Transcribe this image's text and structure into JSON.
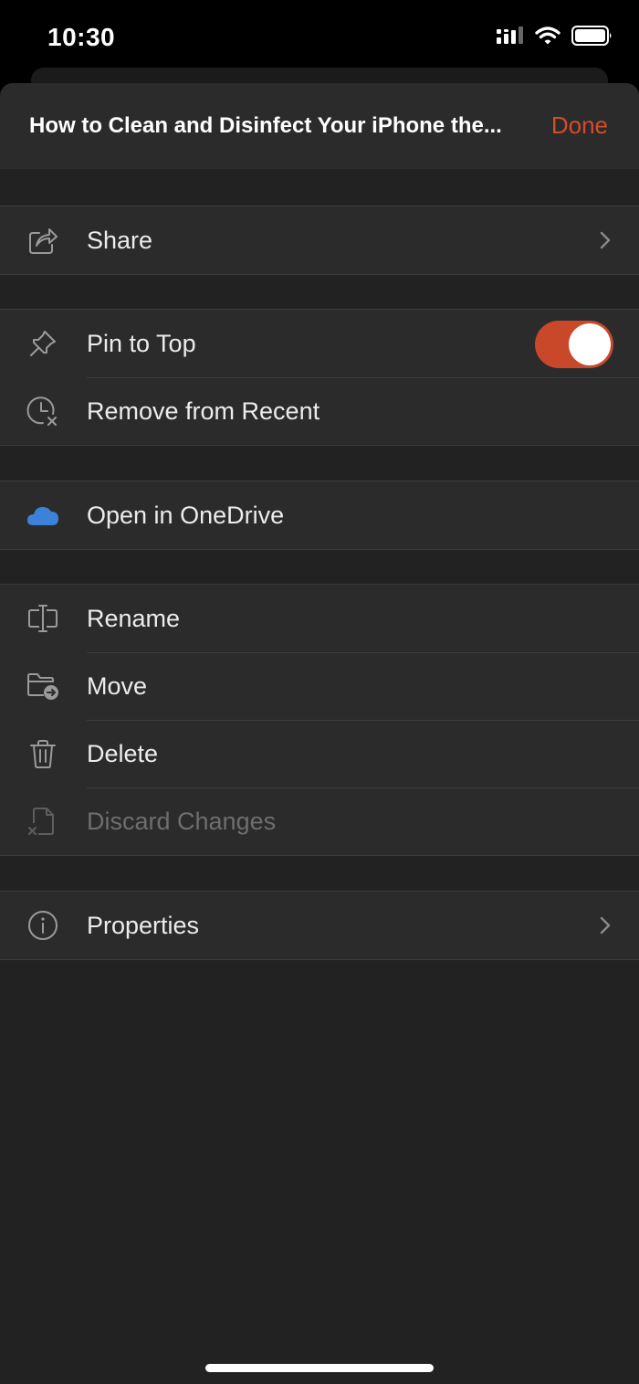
{
  "status_bar": {
    "time": "10:30"
  },
  "header": {
    "title": "How to Clean and Disinfect Your iPhone the...",
    "done_label": "Done"
  },
  "groups": [
    {
      "items": [
        {
          "label": "Share",
          "icon": "share-icon",
          "chevron": true
        }
      ]
    },
    {
      "items": [
        {
          "label": "Pin to Top",
          "icon": "pin-icon",
          "toggle_on": true
        },
        {
          "label": "Remove from Recent",
          "icon": "clock-remove-icon"
        }
      ]
    },
    {
      "items": [
        {
          "label": "Open in OneDrive",
          "icon": "onedrive-icon"
        }
      ]
    },
    {
      "items": [
        {
          "label": "Rename",
          "icon": "rename-icon"
        },
        {
          "label": "Move",
          "icon": "move-folder-icon"
        },
        {
          "label": "Delete",
          "icon": "trash-icon"
        },
        {
          "label": "Discard Changes",
          "icon": "discard-file-icon",
          "disabled": true
        }
      ]
    },
    {
      "items": [
        {
          "label": "Properties",
          "icon": "info-icon",
          "chevron": true
        }
      ]
    }
  ],
  "colors": {
    "accent": "#d24d2b",
    "toggle": "#c9482a",
    "sheet": "#222222",
    "row": "#2b2b2b",
    "onedrive": "#3b82d9"
  }
}
